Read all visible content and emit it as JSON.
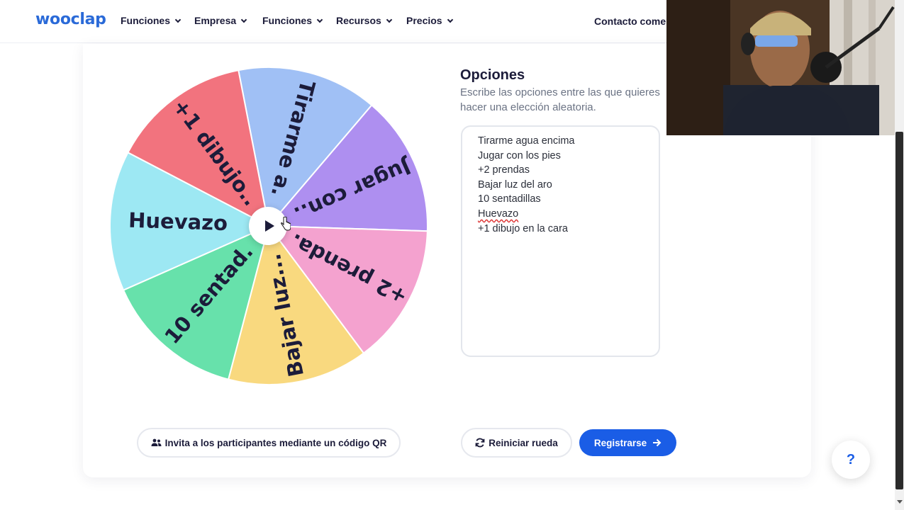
{
  "brand": {
    "logo": "wooclap",
    "accent": "#1a5de6"
  },
  "nav": {
    "items": [
      {
        "label": "Funciones"
      },
      {
        "label": "Empresa"
      },
      {
        "label": "Funciones"
      },
      {
        "label": "Recursos"
      },
      {
        "label": "Precios"
      }
    ],
    "contact": "Contacto comercial"
  },
  "wheel": {
    "play_icon": "play-icon",
    "segments": [
      {
        "label": "Tirarme a.",
        "color": "#a0c0f5"
      },
      {
        "label": "Jugar con..",
        "color": "#ae8ff0"
      },
      {
        "label": "+2 prenda.",
        "color": "#f4a2cf"
      },
      {
        "label": "Bajar luz...",
        "color": "#f9d97f"
      },
      {
        "label": "10 sentad.",
        "color": "#67e1ab"
      },
      {
        "label": "Huevazo",
        "color": "#9de8f3"
      },
      {
        "label": "+1 dibujo..",
        "color": "#f2737e"
      }
    ]
  },
  "options": {
    "title": "Opciones",
    "description": "Escribe las opciones entre las que quieres hacer una elección aleatoria.",
    "lines": [
      "Tirarme agua encima",
      "Jugar con los pies",
      "+2 prendas",
      "Bajar luz del aro",
      "10 sentadillas",
      "Huevazo",
      "+1 dibujo en la cara"
    ]
  },
  "buttons": {
    "qr": "Invita a los participantes mediante un código QR",
    "reset": "Reiniciar rueda",
    "register": "Registrarse"
  },
  "help": {
    "label": "?"
  }
}
